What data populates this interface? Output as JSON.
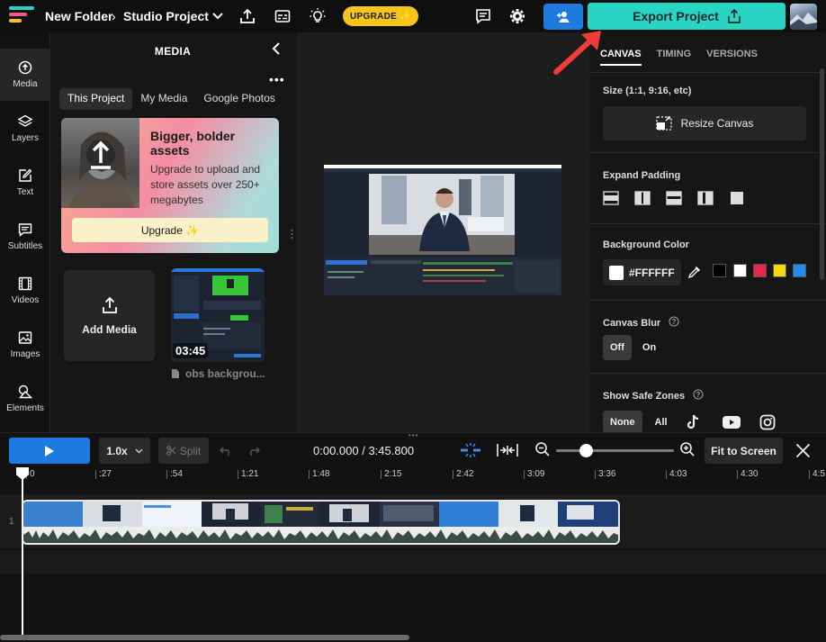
{
  "topbar": {
    "folder": "New Folder",
    "separator": "›",
    "project": "Studio Project",
    "upgrade_label": "UPGRADE ✨",
    "export_label": "Export Project"
  },
  "leftnav": {
    "items": [
      {
        "label": "Media",
        "icon": "media-icon"
      },
      {
        "label": "Layers",
        "icon": "layers-icon"
      },
      {
        "label": "Text",
        "icon": "text-icon"
      },
      {
        "label": "Subtitles",
        "icon": "subtitles-icon"
      },
      {
        "label": "Videos",
        "icon": "videos-icon"
      },
      {
        "label": "Images",
        "icon": "images-icon"
      },
      {
        "label": "Elements",
        "icon": "elements-icon"
      }
    ]
  },
  "media": {
    "title": "MEDIA",
    "tabs": [
      "This Project",
      "My Media",
      "Google Photos"
    ],
    "promo": {
      "title": "Bigger, bolder assets",
      "description": "Upgrade to upload and store assets over 250+ megabytes",
      "button": "Upgrade ✨"
    },
    "add_media": "Add Media",
    "file": {
      "duration": "03:45",
      "name": "obs backgrou..."
    }
  },
  "right": {
    "tabs": [
      "CANVAS",
      "TIMING",
      "VERSIONS"
    ],
    "size_label": "Size (1:1, 9:16, etc)",
    "resize_button": "Resize Canvas",
    "padding_label": "Expand Padding",
    "bg_label": "Background Color",
    "bg_value": "#FFFFFF",
    "swatches": [
      "#000000",
      "#ffffff",
      "#e8264a",
      "#f5d90a",
      "#1f8ef0"
    ],
    "blur_label": "Canvas Blur",
    "blur_options": [
      "Off",
      "On"
    ],
    "safe_label": "Show Safe Zones",
    "safe_options": [
      "None",
      "All"
    ]
  },
  "timeline": {
    "speed": "1.0x",
    "split": "Split",
    "timecode": "0:00.000 / 3:45.800",
    "fit": "Fit to Screen",
    "track_number": "1",
    "ticks": [
      "0",
      ":27",
      ":54",
      "1:21",
      "1:48",
      "2:15",
      "2:42",
      "3:09",
      "3:36",
      "4:03",
      "4:30",
      "4:5"
    ],
    "playhead_seconds": 0,
    "duration_seconds": 225.8
  },
  "colors": {
    "accent": "#28d5c5",
    "primary_blue": "#1f7ae0",
    "upgrade_yellow": "#f5c518",
    "annotation_red": "#ee3b3b"
  }
}
